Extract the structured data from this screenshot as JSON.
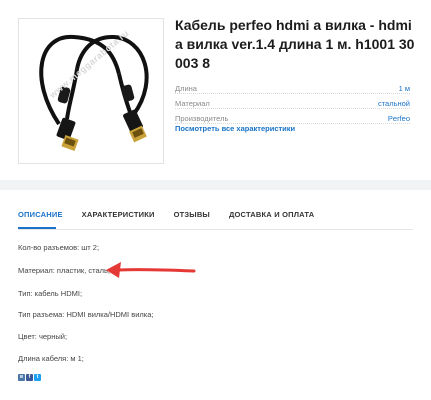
{
  "product": {
    "title": "Кабель perfeo hdmi а вилка - hdmi а вилка ver.1.4 длина 1 м. h1001 30 003 8",
    "image_alt": "HDMI cable",
    "watermark": "www.meggarabota.ru",
    "specs": [
      {
        "name": "Длина",
        "value": "1 м"
      },
      {
        "name": "Материал",
        "value": "стальной"
      },
      {
        "name": "Производитель",
        "value": "Perfeo"
      }
    ],
    "all_specs_link": "Посмотреть все характеристики"
  },
  "tabs": [
    {
      "label": "ОПИСАНИЕ",
      "active": true
    },
    {
      "label": "ХАРАКТЕРИСТИКИ",
      "active": false
    },
    {
      "label": "ОТЗЫВЫ",
      "active": false
    },
    {
      "label": "ДОСТАВКА И ОПЛАТА",
      "active": false
    }
  ],
  "description": [
    "Кол-во разъемов: шт 2;",
    "Материал: пластик, сталь;",
    "Тип: кабель HDMI;",
    "Тип разъема: HDMI вилка/HDMI вилка;",
    "Цвет: черный;",
    "Длина кабеля: м 1;"
  ],
  "share": [
    {
      "icon": "vk-icon",
      "glyph": "в"
    },
    {
      "icon": "facebook-icon",
      "glyph": "f"
    },
    {
      "icon": "twitter-icon",
      "glyph": "t"
    }
  ],
  "colors": {
    "accent": "#1a73c8",
    "annotation_arrow": "#e53935"
  }
}
